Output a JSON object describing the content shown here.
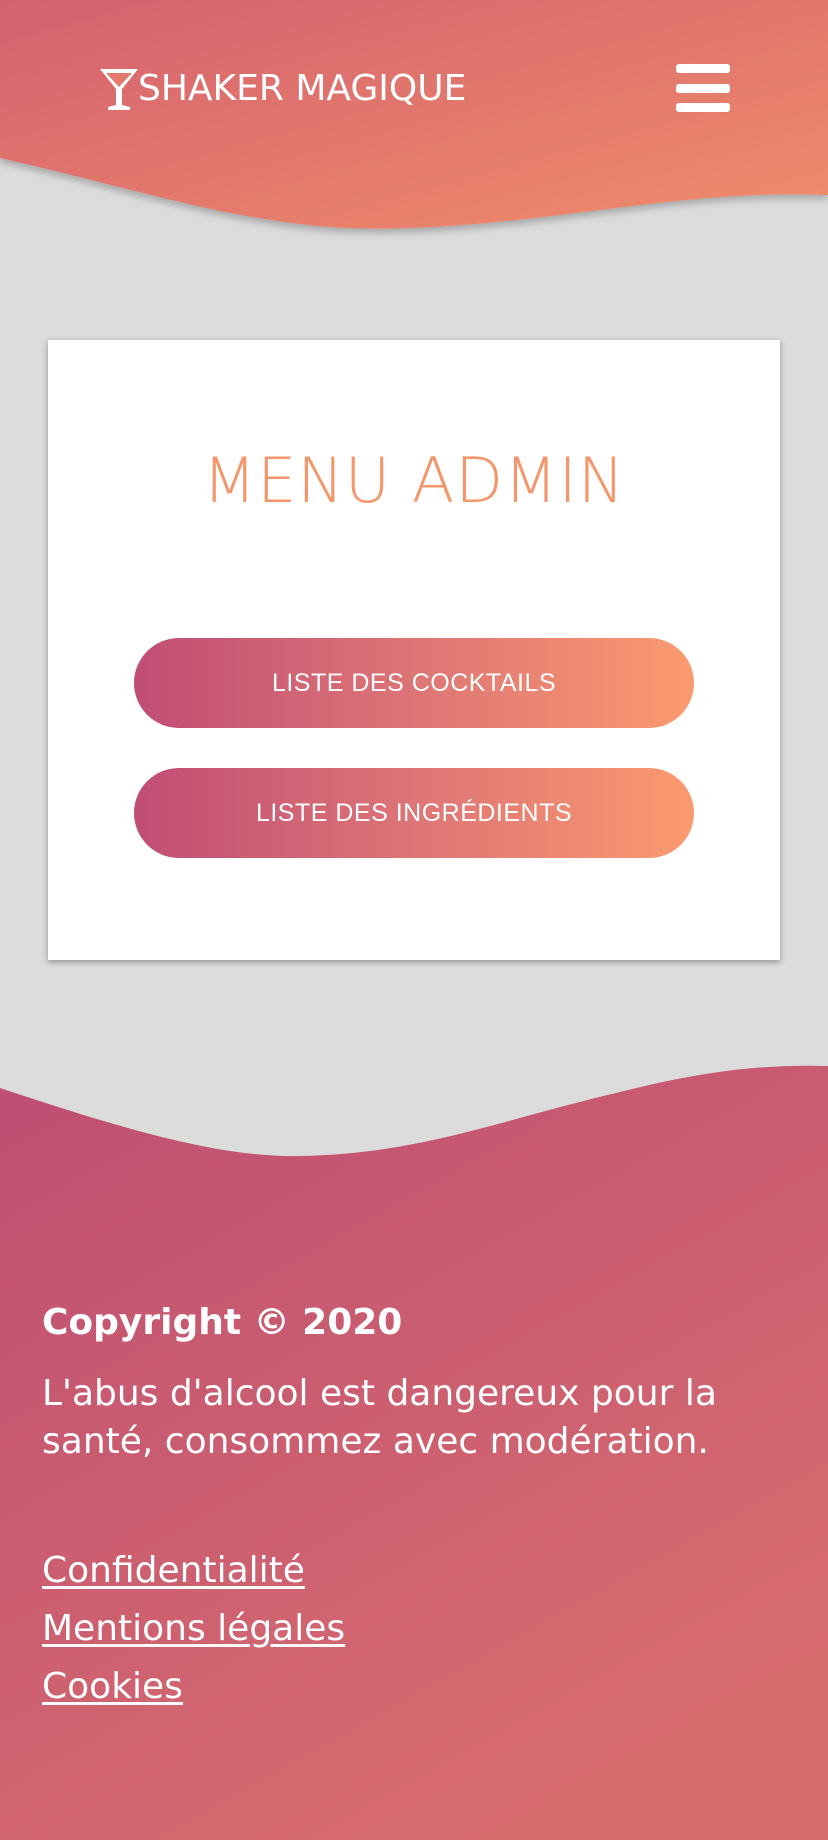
{
  "header": {
    "brand": "SHAKER MAGIQUE",
    "brand_icon": "cocktail-glass-icon",
    "menu_icon": "hamburger-menu-icon"
  },
  "main": {
    "title": "MENU ADMIN",
    "buttons": [
      {
        "label": "LISTE DES COCKTAILS"
      },
      {
        "label": "LISTE DES INGRÉDIENTS"
      }
    ]
  },
  "footer": {
    "copyright": "Copyright © 2020",
    "disclaimer": "L'abus d'alcool est dangereux pour la santé, consommez avec modération.",
    "links": [
      {
        "label": "Confidentialité"
      },
      {
        "label": "Mentions légales"
      },
      {
        "label": "Cookies"
      }
    ]
  },
  "colors": {
    "header_gradient_start": "#d8676f",
    "header_gradient_end": "#ee8a6c",
    "footer_gradient_start": "#bf4f73",
    "footer_gradient_end": "#d86d6e",
    "button_gradient_start": "#c04d75",
    "button_gradient_end": "#fb9a6f",
    "title_color": "#f4956a",
    "background": "#dcdcdc"
  }
}
